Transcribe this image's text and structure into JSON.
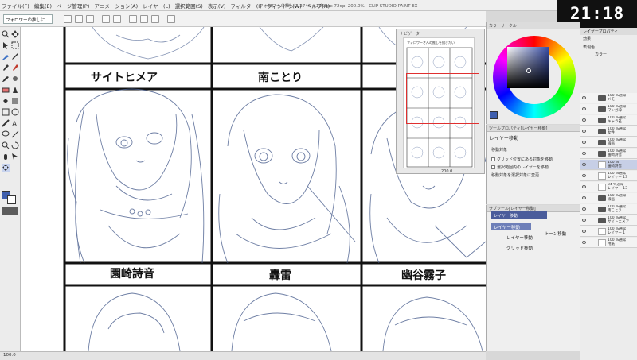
{
  "window": {
    "title": "フォロワーの推しに 2746 x 1058px 72dpi 200.0% - CLIP STUDIO PAINT EX",
    "menu": [
      "ファイル(F)",
      "編集(E)",
      "ページ管理(P)",
      "アニメーション(A)",
      "レイヤー(L)",
      "選択範囲(S)",
      "表示(V)",
      "フィルター(I)",
      "ウィンドウ(W)",
      "ヘルプ(H)"
    ]
  },
  "clock": {
    "time": "21:18"
  },
  "document_tab": {
    "label": "フォロワーの推しに"
  },
  "canvas": {
    "labels": {
      "top_left": "サイトヒメア",
      "top_mid": "南ことり",
      "bottom_left": "園崎詩音",
      "bottom_mid": "轟雷",
      "bottom_right": "幽谷霧子"
    }
  },
  "status_bar": {
    "zoom": "100.0",
    "info": ""
  },
  "navigator": {
    "title": "ナビゲーター",
    "thumb_heading": "フォロワーさんの推しを描きたい",
    "zoom": "200.0"
  },
  "color_panel": {
    "title": "カラーサークル",
    "current_color": "#3f5fae"
  },
  "tool_property": {
    "title": "ツールプロパティ[レイヤー移動]",
    "tool_name": "レイヤー移動",
    "move_target_label": "移動対象",
    "options": [
      "グリッド位置にある対象を移動",
      "選択範囲内のレイヤーを移動",
      "移動対象を選択対象に変更"
    ]
  },
  "sub_tool": {
    "title": "サブツール[レイヤー移動]",
    "tab": "レイヤー移動",
    "items": [
      "レイヤー移動",
      "レイヤー移動",
      "トーン移動",
      "グリッド移動"
    ]
  },
  "layer_panel": {
    "title": "レイヤープロパティ",
    "effect_label": "効果",
    "expression_label": "表現色",
    "expression_value": "カラー",
    "layers": [
      {
        "name": "100 %通常\nメモ",
        "type": "folder"
      },
      {
        "name": "100 %通常\nマンガ枠",
        "type": "folder"
      },
      {
        "name": "100 %通常\nキャラ名",
        "type": "folder"
      },
      {
        "name": "100 %通常\n女性",
        "type": "folder"
      },
      {
        "name": "100 %通常\n線画",
        "type": "folder"
      },
      {
        "name": "100 %通常\n園崎詩音",
        "type": "folder"
      },
      {
        "name": "100 %\n園崎詩音",
        "type": "layer",
        "selected": true
      },
      {
        "name": "100 %通常\nレイヤー 13",
        "type": "layer"
      },
      {
        "name": "34 %通常\nレイヤー 13",
        "type": "layer"
      },
      {
        "name": "100 %通常\n線画",
        "type": "folder"
      },
      {
        "name": "100 %通常\n南ことり",
        "type": "folder"
      },
      {
        "name": "100 %通常\nサイトヒメア",
        "type": "folder"
      },
      {
        "name": "100 %通常\nレイヤー 1",
        "type": "layer"
      },
      {
        "name": "100 %通常\n用紙",
        "type": "layer"
      }
    ]
  }
}
